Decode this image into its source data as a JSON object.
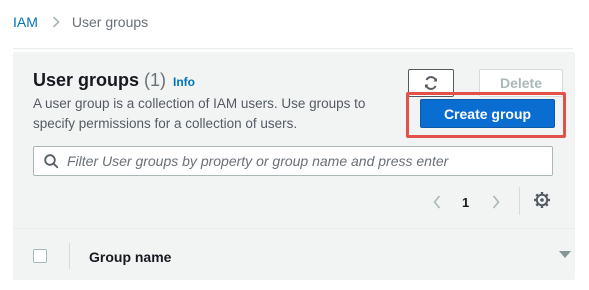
{
  "breadcrumb": {
    "root": "IAM",
    "current": "User groups"
  },
  "header": {
    "title": "User groups",
    "count": "(1)",
    "info": "Info",
    "description": "A user group is a collection of IAM users. Use groups to specify permissions for a collection of users."
  },
  "actions": {
    "refresh_icon": "refresh-icon",
    "delete_label": "Delete",
    "create_label": "Create group"
  },
  "search": {
    "placeholder": "Filter User groups by property or group name and press enter",
    "value": ""
  },
  "pagination": {
    "current_page": "1"
  },
  "table": {
    "columns": [
      "Group name"
    ]
  },
  "colors": {
    "primary": "#0a6dd1",
    "link": "#0073bb",
    "highlight": "#e2524b",
    "panel_bg": "#f2f3f3"
  }
}
